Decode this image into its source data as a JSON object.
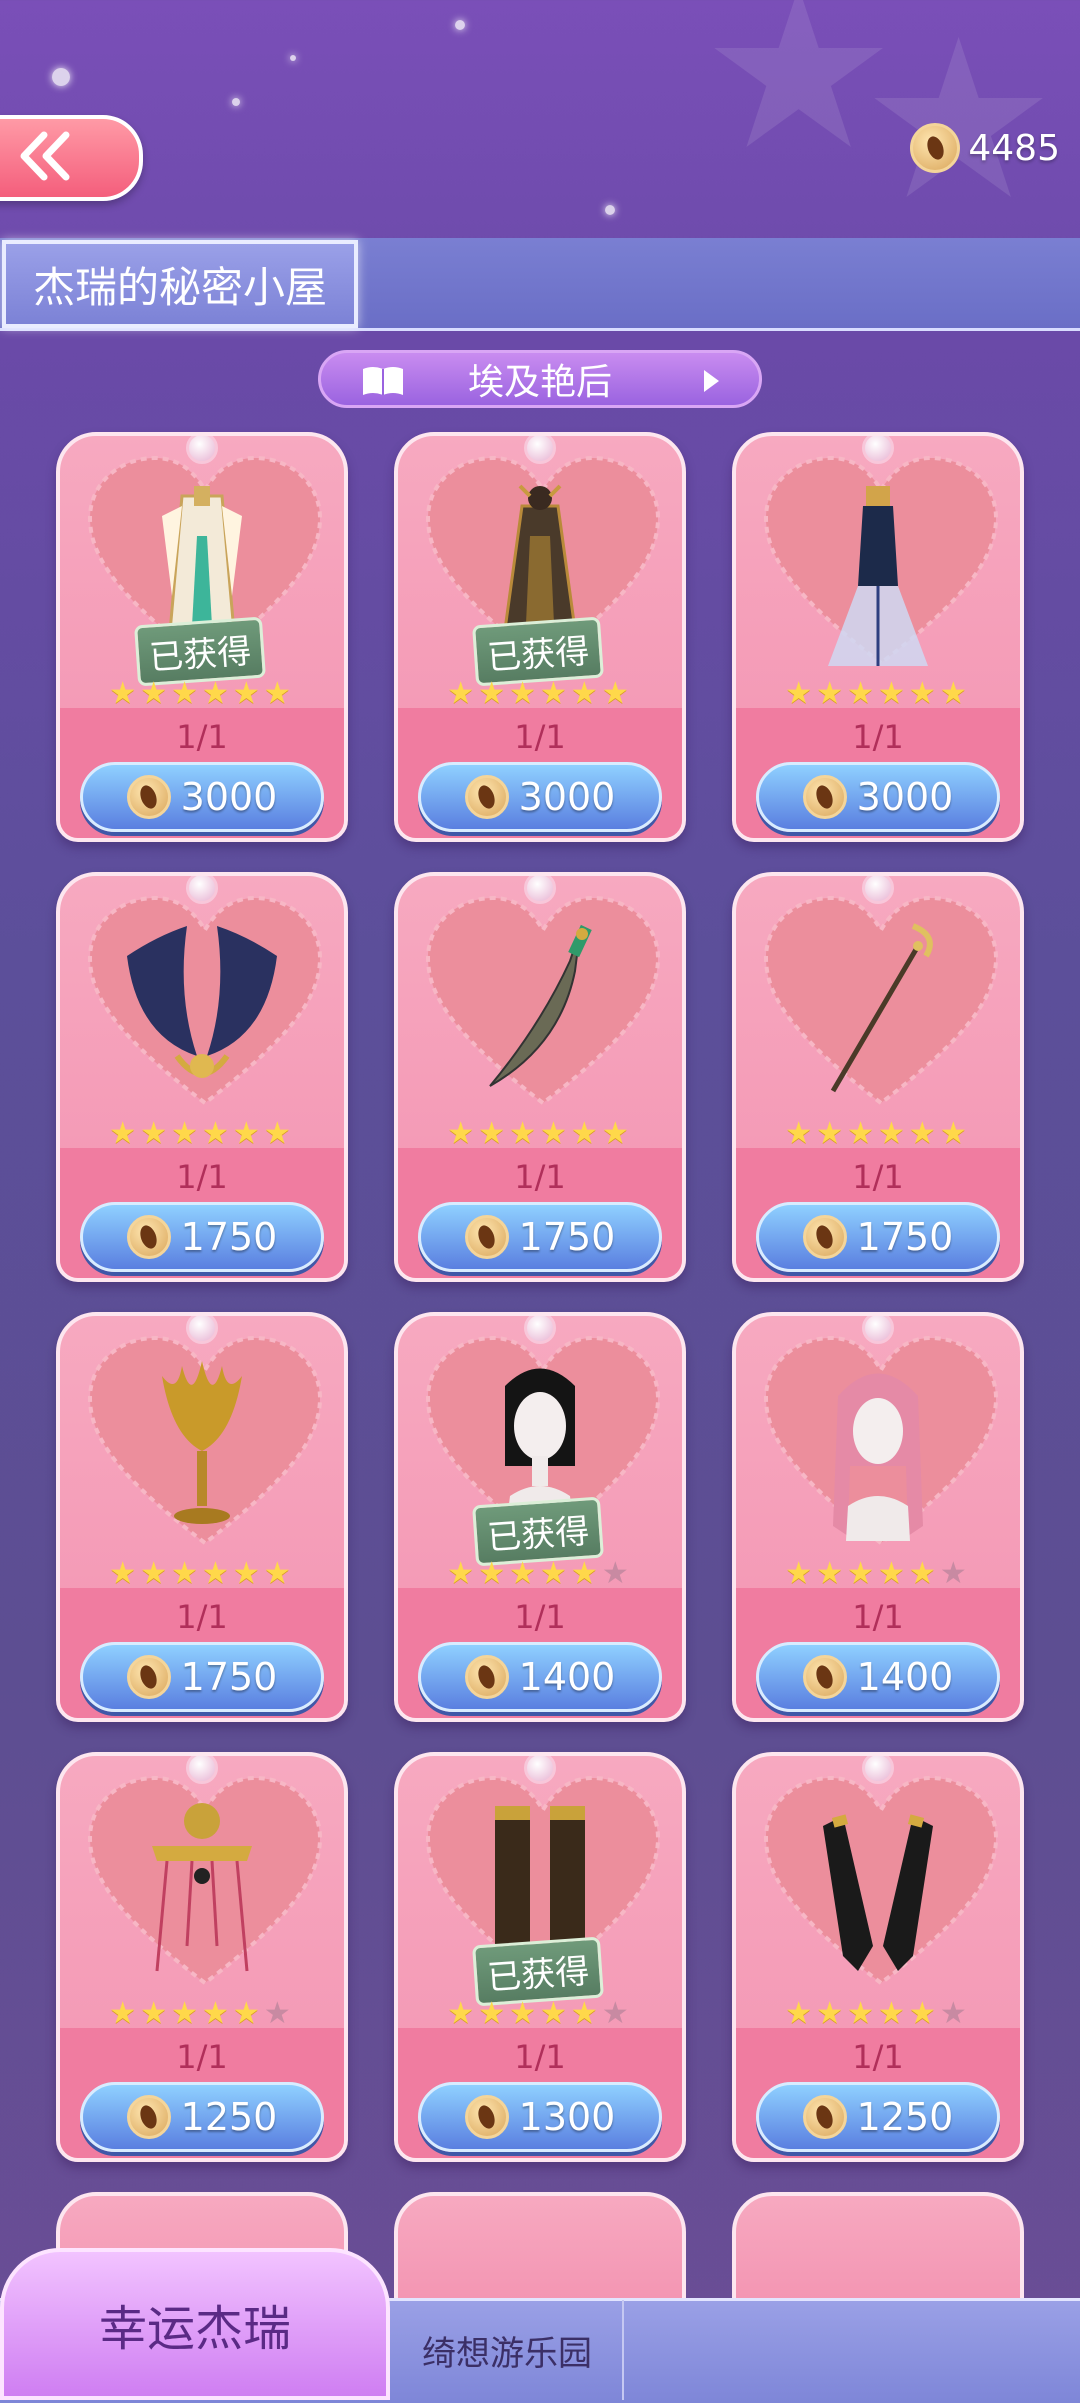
{
  "header": {
    "coins": "4485"
  },
  "title": {
    "label": "杰瑞的秘密小屋"
  },
  "series": {
    "label": "埃及艳后"
  },
  "cards": [
    {
      "item": "robe-white",
      "owned": true,
      "badge": "已获得",
      "stars": 6,
      "max_stars": 6,
      "qty": "1/1",
      "price": "3000"
    },
    {
      "item": "robe-dark",
      "owned": true,
      "badge": "已获得",
      "stars": 6,
      "max_stars": 6,
      "qty": "1/1",
      "price": "3000"
    },
    {
      "item": "dress-blue",
      "owned": false,
      "badge": "",
      "stars": 6,
      "max_stars": 6,
      "qty": "1/1",
      "price": "3000"
    },
    {
      "item": "wings",
      "owned": false,
      "badge": "",
      "stars": 6,
      "max_stars": 6,
      "qty": "1/1",
      "price": "1750"
    },
    {
      "item": "scimitar",
      "owned": false,
      "badge": "",
      "stars": 6,
      "max_stars": 6,
      "qty": "1/1",
      "price": "1750"
    },
    {
      "item": "staff",
      "owned": false,
      "badge": "",
      "stars": 6,
      "max_stars": 6,
      "qty": "1/1",
      "price": "1750"
    },
    {
      "item": "goblet",
      "owned": false,
      "badge": "",
      "stars": 6,
      "max_stars": 6,
      "qty": "1/1",
      "price": "1750"
    },
    {
      "item": "hair-black",
      "owned": true,
      "badge": "已获得",
      "stars": 5,
      "max_stars": 6,
      "qty": "1/1",
      "price": "1400"
    },
    {
      "item": "hair-pink",
      "owned": false,
      "badge": "",
      "stars": 5,
      "max_stars": 6,
      "qty": "1/1",
      "price": "1400"
    },
    {
      "item": "headdress",
      "owned": false,
      "badge": "",
      "stars": 5,
      "max_stars": 6,
      "qty": "1/1",
      "price": "1250"
    },
    {
      "item": "boots",
      "owned": true,
      "badge": "已获得",
      "stars": 5,
      "max_stars": 6,
      "qty": "1/1",
      "price": "1300"
    },
    {
      "item": "gloves",
      "owned": false,
      "badge": "",
      "stars": 5,
      "max_stars": 6,
      "qty": "1/1",
      "price": "1250"
    }
  ],
  "bottom_nav": {
    "tab1": "幸运杰瑞",
    "tab2": "绮想游乐园"
  },
  "colors": {
    "accent": "#f394b2",
    "price_button": "#5a7fe0",
    "nav": "#7e86d8"
  }
}
